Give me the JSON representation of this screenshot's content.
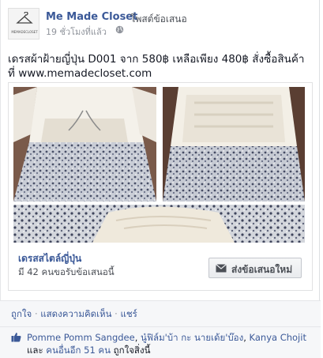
{
  "header": {
    "page_name": "Me Made Closet",
    "post_label": "โพสต์ข้อเสนอ",
    "timestamp": "19 ชั่วโมงที่แล้ว",
    "logo_text": "MEMADECLOSET"
  },
  "message": {
    "text": "เดรสผ้าฝ้ายญี่ปุ่น D001 จาก 580฿ เหลือเพียง 480฿ สั่งซื้อสินค้า ที่ www.memadecloset.com"
  },
  "offer": {
    "title": "เดรสสไตล์ญี่ปุ่น",
    "claimed": "มี 42 คนขอรับข้อเสนอนี้",
    "button_label": "ส่งข้อเสนอใหม่"
  },
  "actions": {
    "like": "ถูกใจ",
    "comment": "แสดงความคิดเห็น",
    "share": "แชร์",
    "separator": "·"
  },
  "likes": {
    "name1": "Pomme Pomm Sangdee",
    "name2": "นู๋ฟิล์ม'บ้า กะ นายเด้ย'บ๊อง",
    "name3": "Kanya Chojit",
    "comma": ", ",
    "and_others": " และ ",
    "others": "คนอื่นอีก 51 คน",
    "suffix": " ถูกใจสิ่งนี้"
  },
  "colors": {
    "link_blue": "#3b5998",
    "muted_gray": "#90949c",
    "feedback_bg": "#f6f7f9"
  }
}
